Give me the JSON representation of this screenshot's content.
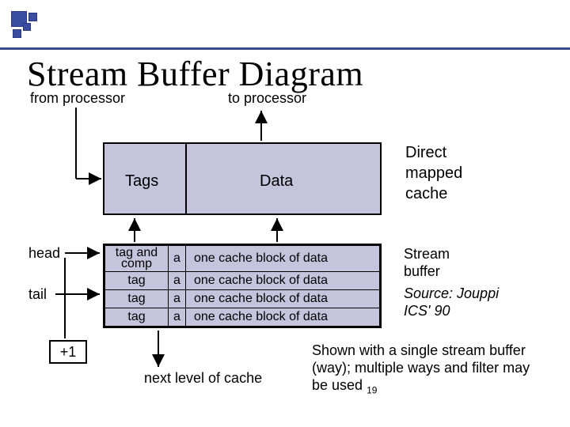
{
  "title": "Stream Buffer Diagram",
  "from_processor": "from processor",
  "to_processor": "to processor",
  "cache": {
    "tags_label": "Tags",
    "data_label": "Data",
    "caption_line1": "Direct",
    "caption_line2": "mapped",
    "caption_line3": "cache"
  },
  "buffer": {
    "rows": [
      {
        "c0a": "tag and",
        "c0b": "comp",
        "c1": "a",
        "c2": "one cache block of data"
      },
      {
        "c0": "tag",
        "c1": "a",
        "c2": "one cache block of data"
      },
      {
        "c0": "tag",
        "c1": "a",
        "c2": "one cache block of data"
      },
      {
        "c0": "tag",
        "c1": "a",
        "c2": "one cache block of data"
      }
    ],
    "head_label": "head",
    "tail_label": "tail",
    "plus1_label": "+1",
    "caption_stream_line1": "Stream",
    "caption_stream_line2": "buffer",
    "caption_source_line1": "Source: Jouppi",
    "caption_source_line2": "ICS' 90"
  },
  "next_level": "next level of cache",
  "footer": {
    "line1": "Shown with a single stream buffer",
    "line2": "(way); multiple ways and filter may",
    "line3": "be used",
    "page_number": "19"
  }
}
